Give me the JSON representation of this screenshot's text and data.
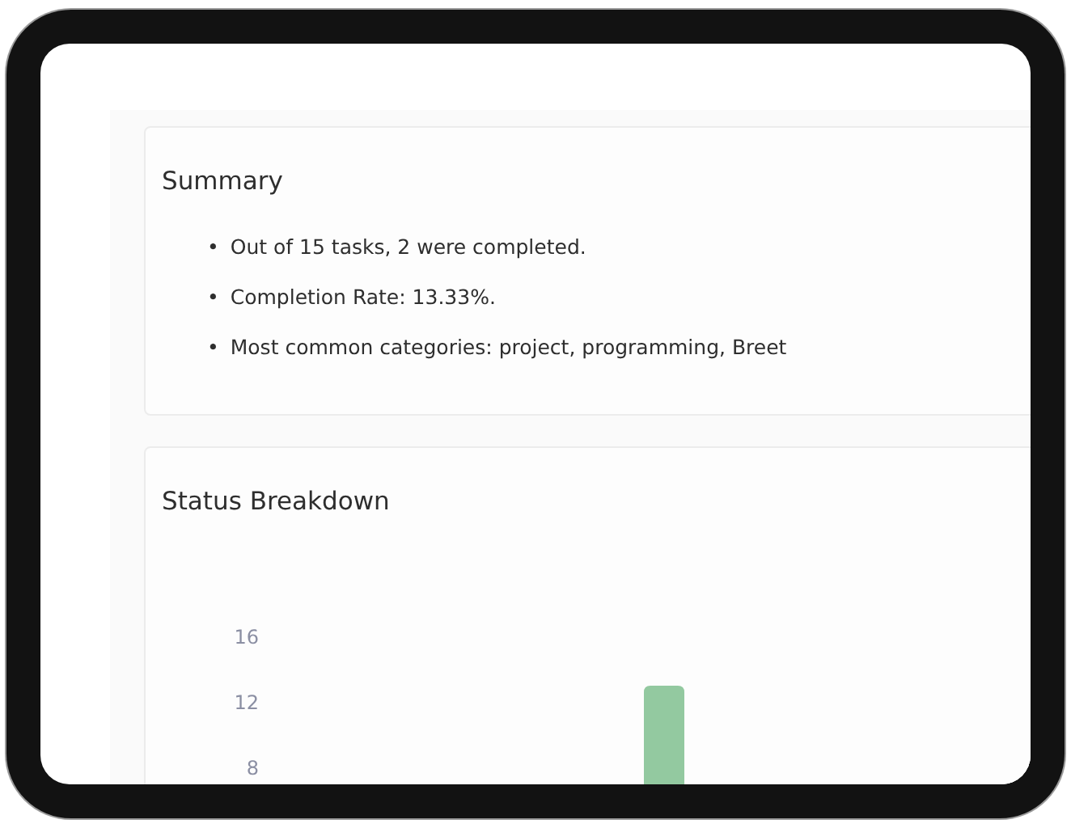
{
  "summary": {
    "title": "Summary",
    "items": [
      {
        "marker": "•",
        "text": "Out of 15 tasks, 2 were completed."
      },
      {
        "marker": "•",
        "text": "Completion Rate: 13.33%."
      },
      {
        "marker": "•",
        "text": "Most common categories: project, programming, Breet"
      }
    ]
  },
  "status_breakdown": {
    "title": "Status Breakdown",
    "y_axis_labels": [
      "16",
      "12",
      "8"
    ]
  }
}
